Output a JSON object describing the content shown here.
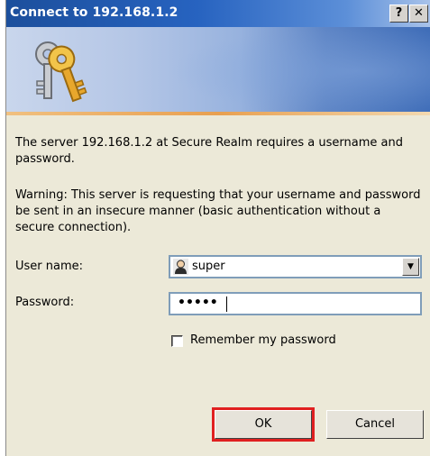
{
  "window": {
    "title": "Connect to 192.168.1.2",
    "help_label": "?",
    "close_label": "✕"
  },
  "banner": {
    "icon": "keys-icon"
  },
  "message": {
    "line1": "The server 192.168.1.2 at Secure Realm requires a username and password.",
    "warning": "Warning: This server is requesting that your username and password be sent in an insecure manner (basic authentication without a secure connection)."
  },
  "form": {
    "username_label": "User name:",
    "username_value": "super",
    "password_label": "Password:",
    "password_value": "•••••",
    "remember_label": "Remember my password",
    "remember_checked": false
  },
  "buttons": {
    "ok_label": "OK",
    "cancel_label": "Cancel"
  },
  "colors": {
    "titlebar": "#2763c0",
    "highlight": "#e02020",
    "dialog_bg": "#ece9d8"
  }
}
